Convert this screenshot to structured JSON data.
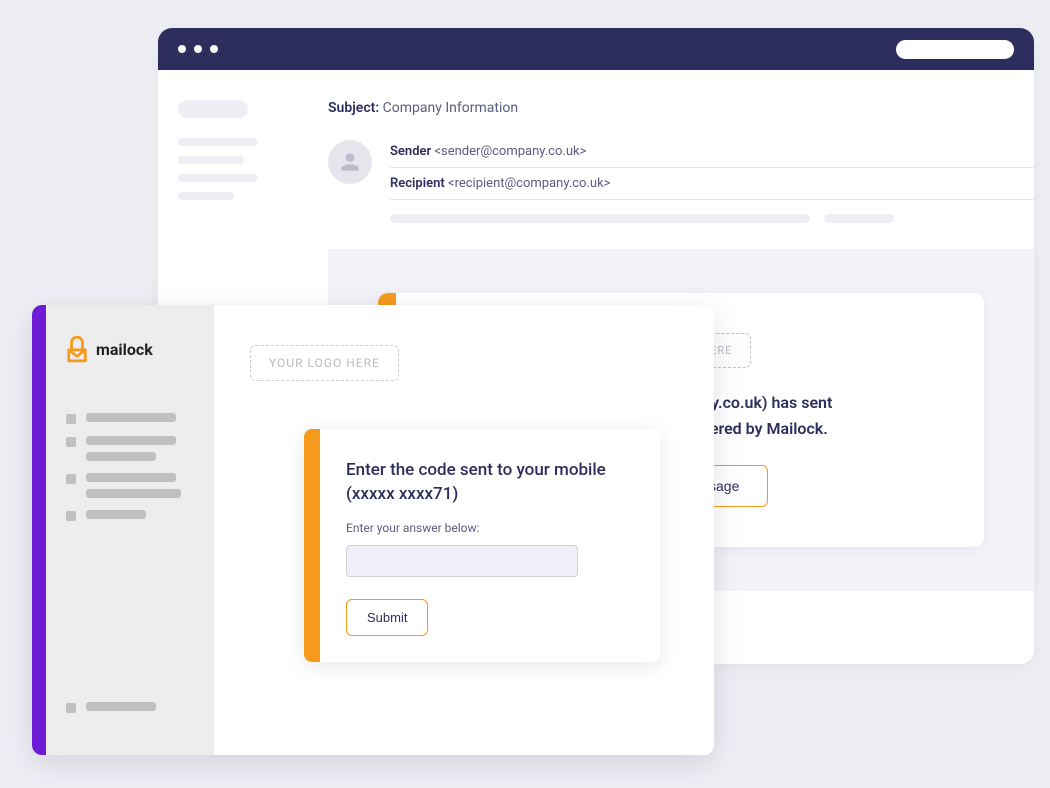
{
  "email": {
    "subject_label": "Subject:",
    "subject_value": "Company Information",
    "sender_label": "Sender",
    "sender_addr": "<sender@company.co.uk>",
    "recipient_label": "Recipient",
    "recipient_addr": "<recipient@company.co.uk>",
    "notice": {
      "logo_placeholder": "YOUR LOGO HERE",
      "text_line1": "Sender (sender@company.co.uk) has sent",
      "text_line2": "you a secure email, delivered by Mailock.",
      "button": "Read my message"
    }
  },
  "mailock": {
    "brand": "mailock",
    "logo_placeholder": "YOUR LOGO HERE",
    "code_card": {
      "title_line1": "Enter the code sent to your mobile",
      "title_line2": "(xxxxx xxxx71)",
      "sub": "Enter your answer below:",
      "input_value": "",
      "submit": "Submit"
    }
  }
}
